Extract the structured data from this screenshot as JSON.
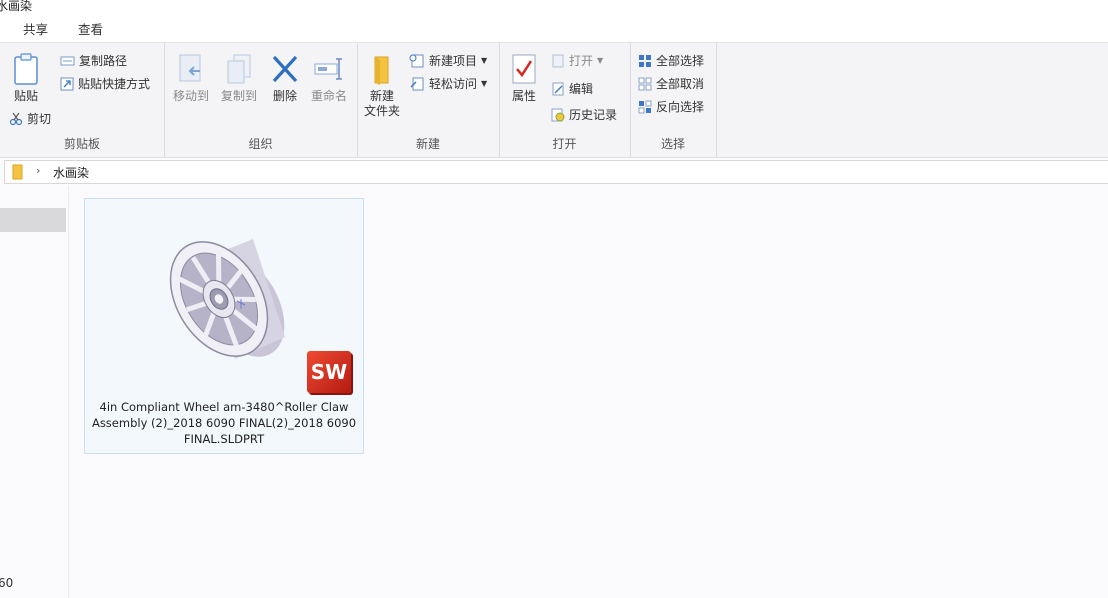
{
  "window": {
    "title": "水画染"
  },
  "tabs": [
    {
      "label": "共享"
    },
    {
      "label": "查看"
    }
  ],
  "ribbon": {
    "clipboard": {
      "group_label": "剪贴板",
      "paste": "贴贴",
      "copy_path": "复制路径",
      "paste_shortcut": "贴贴快捷方式",
      "cut": "剪切"
    },
    "organize": {
      "group_label": "组织",
      "move_to": "移动到",
      "copy_to": "复制到",
      "delete": "删除",
      "rename": "重命名"
    },
    "new": {
      "group_label": "新建",
      "new_folder_line1": "新建",
      "new_folder_line2": "文件夹",
      "new_item": "新建项目",
      "easy_access": "轻松访问"
    },
    "open": {
      "group_label": "打开",
      "properties": "属性",
      "open": "打开",
      "edit": "编辑",
      "history": "历史记录"
    },
    "select": {
      "group_label": "选择",
      "select_all": "全部选择",
      "select_none": "全部取消",
      "invert": "反向选择"
    }
  },
  "address_bar": {
    "path": "水画染"
  },
  "nav_pane": {
    "footer_text": "60"
  },
  "file": {
    "name_line1": "4in Compliant Wheel am-3480^Roller Claw",
    "name_line2": "Assembly (2)_2018 6090 FINAL(2)_2018 6090",
    "name_line3": "FINAL.SLDPRT",
    "badge_text": "SW"
  },
  "colors": {
    "accent_blue": "#3d77c5",
    "delete_blue": "#2e6fc0",
    "folder_yellow": "#f5c342",
    "sw_red": "#d8261c"
  }
}
